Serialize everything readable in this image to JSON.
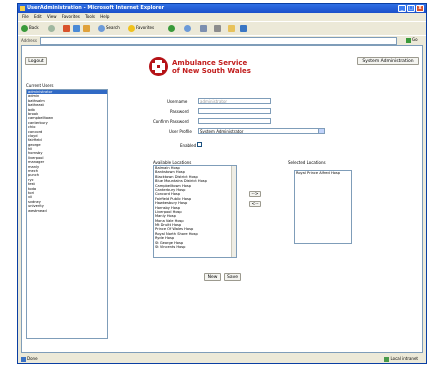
{
  "window": {
    "title": "UserAdministration - Microsoft Internet Explorer",
    "min_glyph": "_",
    "max_glyph": "□",
    "close_glyph": "x"
  },
  "menu": [
    "File",
    "Edit",
    "View",
    "Favorites",
    "Tools",
    "Help"
  ],
  "toolbar": {
    "back": "Back",
    "search": "Search",
    "favorites": "Favorites"
  },
  "address": {
    "label": "Address",
    "go": "Go"
  },
  "page": {
    "logout": "Logout",
    "system_admin": "System Administration",
    "brand_line1": "Ambulance Service",
    "brand_line2": "of New South Wales",
    "current_users_label": "Current Users",
    "current_users": [
      "administrator",
      "admin",
      "bathsalm",
      "batheast",
      "bdb",
      "brook",
      "campbelltown",
      "canterbury",
      "chio",
      "concord",
      "cloyd",
      "fairfield",
      "george",
      "hii",
      "hornsby",
      "liverpool",
      "manager",
      "manly",
      "mech",
      "punch",
      "ryc",
      "test",
      "toda",
      "tori",
      "vii",
      "svdney",
      "univerity",
      "westmead"
    ],
    "username_label": "Username",
    "username_value": "administrator",
    "password_label": "Password",
    "confirm_password_label": "Confirm Password",
    "user_profile_label": "User Profile",
    "user_profile_value": "System Administrator",
    "enabled_label": "Enabled",
    "available_label": "Available Locations",
    "selected_label": "Selected Locations",
    "available_locations": [
      "Balmain Hosp",
      "Bankstown Hosp",
      "Blacktown District Hosp",
      "Blue Mountains District Hosp",
      "Campbelltown Hosp",
      "Canterbury Hosp",
      "Concord Hosp",
      "Fairfield Public Hosp",
      "Hawkesbury Hosp",
      "Hornsby Hosp",
      "Liverpool Hosp",
      "Manly Hosp",
      "Mona Vale Hosp",
      "Mt Druitt Hosp",
      "Prince Of Wales Hosp",
      "Royal North Shore Hosp",
      "Ryde Hosp",
      "St George Hosp",
      "St Vincents Hosp"
    ],
    "selected_locations": [
      "Royal Prince Alfred Hosp"
    ],
    "move_right": "-->",
    "move_left": "<--",
    "new_button": "New",
    "save_button": "Save"
  },
  "status": {
    "left": "Done",
    "right": "Local intranet"
  }
}
